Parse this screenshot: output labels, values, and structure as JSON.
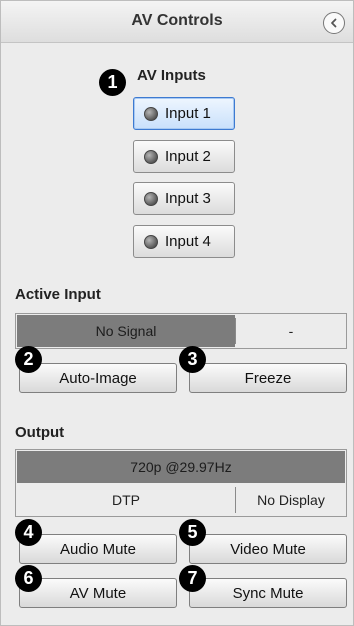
{
  "header": {
    "title": "AV Controls",
    "collapse_icon": "chevron-left-icon"
  },
  "callouts": [
    "1",
    "2",
    "3",
    "4",
    "5",
    "6",
    "7"
  ],
  "av_inputs": {
    "label": "AV Inputs",
    "items": [
      {
        "label": "Input 1",
        "selected": true
      },
      {
        "label": "Input 2",
        "selected": false
      },
      {
        "label": "Input 3",
        "selected": false
      },
      {
        "label": "Input 4",
        "selected": false
      }
    ]
  },
  "active_input": {
    "label": "Active Input",
    "signal_status": "No Signal",
    "resolution": "-",
    "auto_image_label": "Auto-Image",
    "freeze_label": "Freeze"
  },
  "output": {
    "label": "Output",
    "format": "720p @29.97Hz",
    "type": "DTP",
    "display_status": "No Display",
    "audio_mute_label": "Audio Mute",
    "video_mute_label": "Video Mute",
    "av_mute_label": "AV Mute",
    "sync_mute_label": "Sync Mute"
  },
  "colors": {
    "selected_border": "#3d7ad1",
    "status_bar": "#7c7c7c",
    "badge": "#000000"
  }
}
